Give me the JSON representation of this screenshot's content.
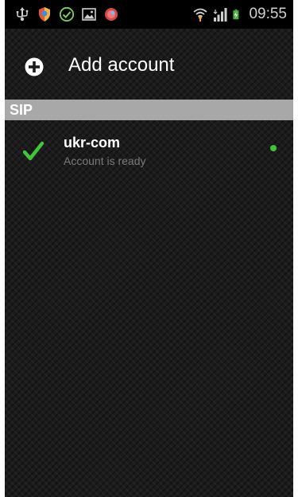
{
  "status_bar": {
    "time": "09:55",
    "left_icons": [
      "usb-icon",
      "shield-icon",
      "check-circle-icon",
      "image-icon",
      "app-notification-icon"
    ],
    "right_icons": [
      "wifi-icon",
      "signal-icon",
      "battery-charging-icon"
    ]
  },
  "add_account": {
    "label": "Add account",
    "icon": "plus-circle-icon"
  },
  "section": {
    "label": "SIP"
  },
  "accounts": [
    {
      "name": "ukr-com",
      "status": "Account is ready",
      "check_color": "#3fc43a",
      "dot_color": "#3fc43a"
    }
  ],
  "colors": {
    "background": "#1b1b1b",
    "section_header": "#a8a8a8",
    "accent_green": "#3fc43a"
  }
}
